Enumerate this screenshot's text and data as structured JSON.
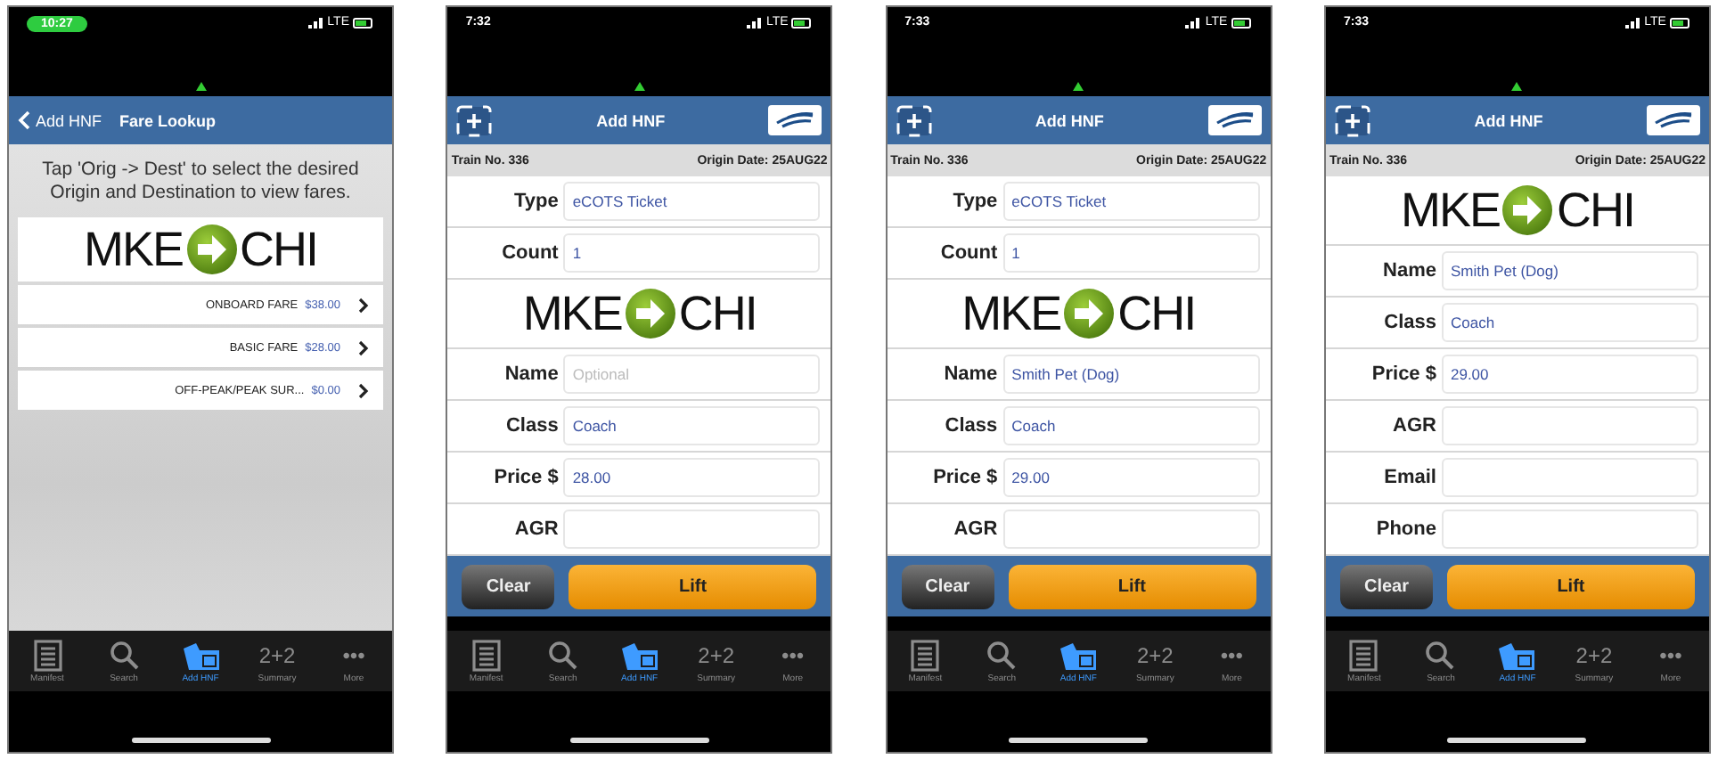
{
  "phones": [
    {
      "kind": "fare_lookup",
      "status_time": "10:27",
      "network": "LTE",
      "nav": {
        "back": "Add HNF",
        "title": "Fare Lookup"
      },
      "instructions": "Tap 'Orig -> Dest' to select the desired Origin and Destination to view fares.",
      "route": {
        "origin": "MKE",
        "destination": "CHI"
      },
      "fares": [
        {
          "label": "ONBOARD FARE",
          "amount": "$38.00"
        },
        {
          "label": "BASIC FARE",
          "amount": "$28.00"
        },
        {
          "label": "OFF-PEAK/PEAK SUR...",
          "amount": "$0.00"
        }
      ],
      "tabs": [
        {
          "kind": "list",
          "label": "Manifest",
          "selected": false
        },
        {
          "kind": "search",
          "label": "Search",
          "selected": false
        },
        {
          "kind": "tickets",
          "label": "Add HNF",
          "selected": true
        },
        {
          "kind": "glyph",
          "glyph": "2+2",
          "label": "Summary",
          "selected": false
        },
        {
          "kind": "glyph",
          "glyph": "•••",
          "label": "More",
          "selected": false
        }
      ]
    },
    {
      "kind": "form",
      "status_time": "7:32",
      "network": "LTE",
      "title": "Add HNF",
      "train_no": "Train No. 336",
      "origin_date": "Origin Date: 25AUG22",
      "rows": [
        {
          "kind": "field",
          "label": "Type",
          "value": "eCOTS Ticket"
        },
        {
          "kind": "field",
          "label": "Count",
          "value": "1"
        },
        {
          "kind": "route",
          "origin": "MKE",
          "destination": "CHI"
        },
        {
          "kind": "field",
          "label": "Name",
          "placeholder": "Optional"
        },
        {
          "kind": "field",
          "label": "Class",
          "value": "Coach"
        },
        {
          "kind": "field",
          "label": "Price $",
          "value": "28.00"
        },
        {
          "kind": "field",
          "label": "AGR"
        }
      ],
      "buttons": {
        "clear": "Clear",
        "lift": "Lift"
      },
      "tabs": [
        {
          "kind": "list",
          "label": "Manifest",
          "selected": false
        },
        {
          "kind": "search",
          "label": "Search",
          "selected": false
        },
        {
          "kind": "tickets",
          "label": "Add HNF",
          "selected": true
        },
        {
          "kind": "glyph",
          "glyph": "2+2",
          "label": "Summary",
          "selected": false
        },
        {
          "kind": "glyph",
          "glyph": "•••",
          "label": "More",
          "selected": false
        }
      ]
    },
    {
      "kind": "form",
      "status_time": "7:33",
      "network": "LTE",
      "title": "Add HNF",
      "train_no": "Train No. 336",
      "origin_date": "Origin Date: 25AUG22",
      "rows": [
        {
          "kind": "field",
          "label": "Type",
          "value": "eCOTS Ticket"
        },
        {
          "kind": "field",
          "label": "Count",
          "value": "1"
        },
        {
          "kind": "route",
          "origin": "MKE",
          "destination": "CHI"
        },
        {
          "kind": "field",
          "label": "Name",
          "value": "Smith Pet (Dog)"
        },
        {
          "kind": "field",
          "label": "Class",
          "value": "Coach"
        },
        {
          "kind": "field",
          "label": "Price $",
          "value": "29.00"
        },
        {
          "kind": "field",
          "label": "AGR"
        }
      ],
      "buttons": {
        "clear": "Clear",
        "lift": "Lift"
      },
      "tabs": [
        {
          "kind": "list",
          "label": "Manifest",
          "selected": false
        },
        {
          "kind": "search",
          "label": "Search",
          "selected": false
        },
        {
          "kind": "tickets",
          "label": "Add HNF",
          "selected": true
        },
        {
          "kind": "glyph",
          "glyph": "2+2",
          "label": "Summary",
          "selected": false
        },
        {
          "kind": "glyph",
          "glyph": "•••",
          "label": "More",
          "selected": false
        }
      ]
    },
    {
      "kind": "form",
      "status_time": "7:33",
      "network": "LTE",
      "title": "Add HNF",
      "train_no": "Train No. 336",
      "origin_date": "Origin Date: 25AUG22",
      "rows": [
        {
          "kind": "route",
          "origin": "MKE",
          "destination": "CHI"
        },
        {
          "kind": "field",
          "label": "Name",
          "value": "Smith Pet (Dog)"
        },
        {
          "kind": "field",
          "label": "Class",
          "value": "Coach"
        },
        {
          "kind": "field",
          "label": "Price $",
          "value": "29.00"
        },
        {
          "kind": "field",
          "label": "AGR"
        },
        {
          "kind": "field",
          "label": "Email"
        },
        {
          "kind": "field",
          "label": "Phone"
        }
      ],
      "buttons": {
        "clear": "Clear",
        "lift": "Lift"
      },
      "tabs": [
        {
          "kind": "list",
          "label": "Manifest",
          "selected": false
        },
        {
          "kind": "search",
          "label": "Search",
          "selected": false
        },
        {
          "kind": "tickets",
          "label": "Add HNF",
          "selected": true
        },
        {
          "kind": "glyph",
          "glyph": "2+2",
          "label": "Summary",
          "selected": false
        },
        {
          "kind": "glyph",
          "glyph": "•••",
          "label": "More",
          "selected": false
        }
      ]
    }
  ]
}
